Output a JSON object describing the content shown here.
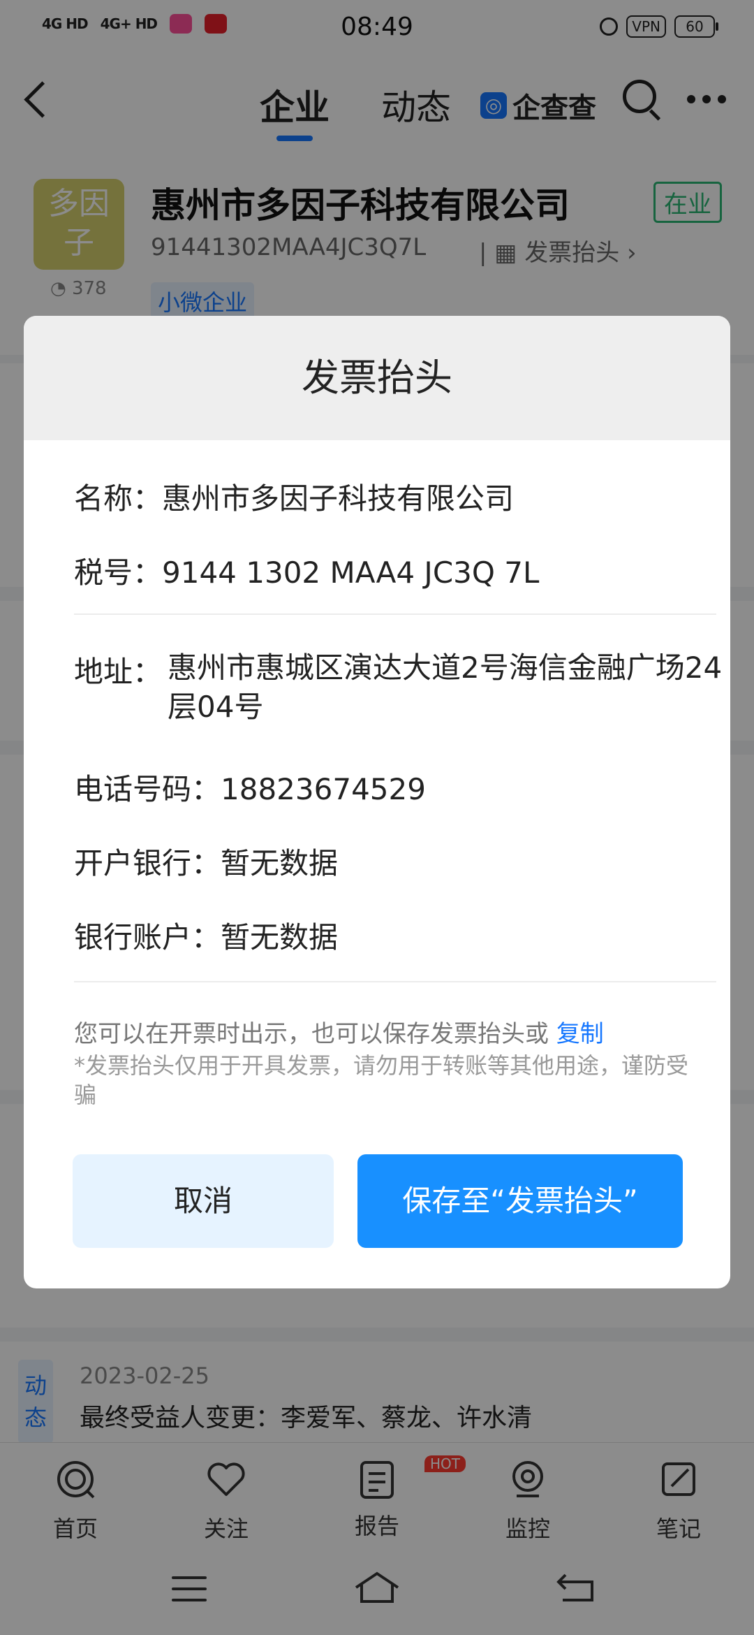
{
  "status_bar": {
    "signal1": "4G HD",
    "signal2": "4G+ HD",
    "time": "08:49",
    "vpn": "VPN",
    "battery": "60"
  },
  "nav": {
    "tabs": [
      "企业",
      "动态"
    ],
    "brand": "企查查"
  },
  "company": {
    "logo_text": "多因子",
    "views": "378",
    "name": "惠州市多因子科技有限公司",
    "status": "在业",
    "code": "91441302MAA4JC3Q7L",
    "invoice_link": "发票抬头",
    "scale": "小微企业"
  },
  "dialog": {
    "title": "发票抬头",
    "rows": [
      {
        "key": "名称：",
        "value": "惠州市多因子科技有限公司"
      },
      {
        "key": "税号：",
        "value": "9144 1302 MAA4 JC3Q 7L"
      },
      {
        "key": "地址：",
        "value": "惠州市惠城区演达大道2号海信金融广场24层04号"
      },
      {
        "key": "电话号码：",
        "value": "18823674529"
      },
      {
        "key": "开户银行：",
        "value": "暂无数据"
      },
      {
        "key": "银行账户：",
        "value": "暂无数据"
      }
    ],
    "note_main": "您可以在开票时出示，也可以保存发票抬头或",
    "copy_label": "复制",
    "note_warning": "*发票抬头仅用于开具发票，请勿用于转账等其他用途，谨防受骗",
    "cancel_label": "取消",
    "save_label": "保存至“发票抬头”"
  },
  "news": {
    "tag": "动态",
    "date": "2023-02-25",
    "text": "最终受益人变更：李爱军、蔡龙、许水清"
  },
  "bottom_tabs": [
    {
      "label": "首页",
      "icon": "home-icon"
    },
    {
      "label": "关注",
      "icon": "heart-icon"
    },
    {
      "label": "报告",
      "icon": "report-icon",
      "badge": "HOT"
    },
    {
      "label": "监控",
      "icon": "monitor-icon"
    },
    {
      "label": "笔记",
      "icon": "note-icon"
    }
  ],
  "colors": {
    "accent": "#1677ff",
    "status_green": "#2bb673",
    "hot_badge": "#ff3b30"
  }
}
